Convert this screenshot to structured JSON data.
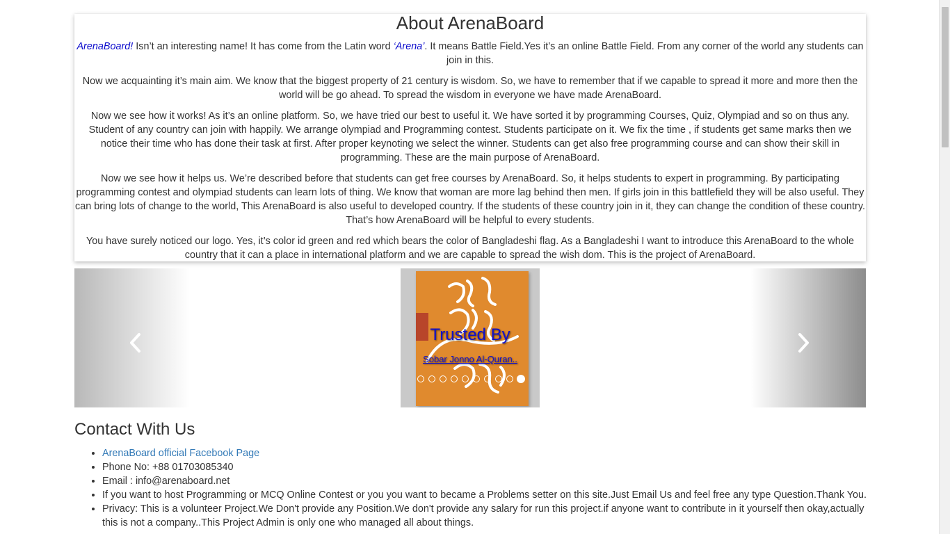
{
  "about": {
    "title": "About ArenaBoard",
    "p1": {
      "brand": "ArenaBoard!",
      "t1": " Isn’t an interesting name! It has come from the Latin word ",
      "word": "‘Arena’",
      "t2": ". It means Battle Field.Yes it’s an online Battle Field. From any corner of the world any students can join in this."
    },
    "p2": "Now we acquainting it’s main aim. We know that the biggest property of 21 century is wisdom. So, we have to remember that if we capable to spread it more and more then the world will be go ahead. To spread the wisdom in everyone we have made ArenaBoard.",
    "p3": "Now we see how it works! As it’s an online platform. So, we have tried our best to useful it. We have sorted it by programming Courses, Quiz, Olympiad and so on thus any. Student of any country can join with happily. We arrange olympiad and Programming contest. Students participate on it. We fix the time , if students get same marks then we notice their time who has done their task at first. After proper keynoting we select the winner. Students can get also free programming course and can show their skill in programming. These are the main purpose of ArenaBoard.",
    "p4": "Now we see how it helps us. We’re described before that students can get free courses by ArenaBoard. So, it helps students to expert in programming. By participating programming contest and olympiad students can learn lots of thing. We know that woman are more lag behind then men. If girls join in this battlefield they will be also useful. They can bring lots of change to the world, This ArenaBoard is also useful to developed country. If the students of these country join in it, they can change the condition of these country. That’s how ArenaBoard will be helpful to every students.",
    "p5": "You have surely noticed our logo. Yes, it’s color id green and red which bears the color of Bangladeshi flag. As a Bangladeshi I want to introduce this ArenaBoard to the whole country that it can a place in international platform and we are capable to spread the wish dom. This is the project of ArenaBoard."
  },
  "carousel": {
    "caption_title": "Trusted By",
    "caption_sub": "Sobar Jonno Al-Quran..",
    "slide_count": 10,
    "active_index": 9,
    "prev_icon": "chevron-left-icon",
    "next_icon": "chevron-right-icon",
    "book_color": "#e08a2e"
  },
  "contact": {
    "title": "Contact With Us",
    "facebook_link": "ArenaBoard official Facebook Page",
    "phone": "Phone No: +88 01703085340",
    "email": "Email : info@arenaboard.net",
    "host": "If you want to host Programming or MCQ Online Contest or you you want to became a Problems setter on this site.Just Email Us and feel free any type Question.Thank You.",
    "privacy": "Privacy: This is a volunteer Project.We Don't provide any Position.We don't provide any salary for run this project.if anyone want to contribute in it yourself then okay,actually this is not a company..This Project Admin is only one who managed all about things."
  },
  "colors": {
    "link": "#337ab7",
    "highlight": "#0b0bcc",
    "caption": "#1010cc"
  }
}
